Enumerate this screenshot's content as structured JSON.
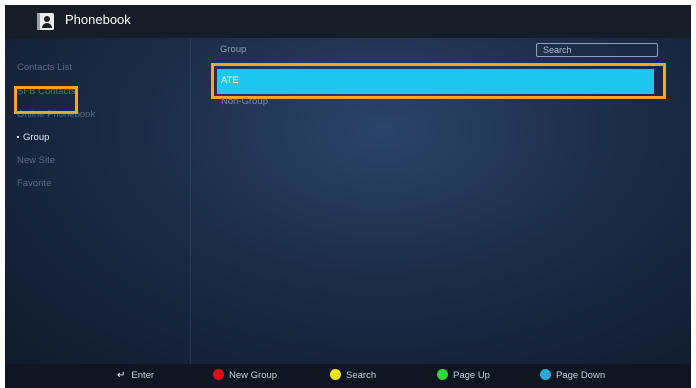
{
  "app": {
    "title": "Phonebook"
  },
  "sidebar": {
    "items": [
      {
        "label": "Contacts List"
      },
      {
        "label": "SFB Contacts"
      },
      {
        "label": "Online Phonebook"
      },
      {
        "label": "Group"
      },
      {
        "label": "New Site"
      },
      {
        "label": "Favorite"
      }
    ],
    "selected_index": 3
  },
  "main": {
    "header": "Group",
    "search_placeholder": "Search",
    "rows": [
      {
        "label": "ATE"
      },
      {
        "label": "Non-Group"
      }
    ],
    "selected_index": 0
  },
  "footer": {
    "hints": [
      {
        "label": "Enter",
        "icon": "enter-icon"
      },
      {
        "label": "New Group",
        "color": "#d7141a"
      },
      {
        "label": "Search",
        "color": "#f2e415"
      },
      {
        "label": "Page Up",
        "color": "#36d33a"
      },
      {
        "label": "Page Down",
        "color": "#29a9e1"
      }
    ]
  },
  "colors": {
    "highlight_outline": "#f5a623",
    "selected_row": "#1ec6ee",
    "titlebar": "#171d27"
  }
}
